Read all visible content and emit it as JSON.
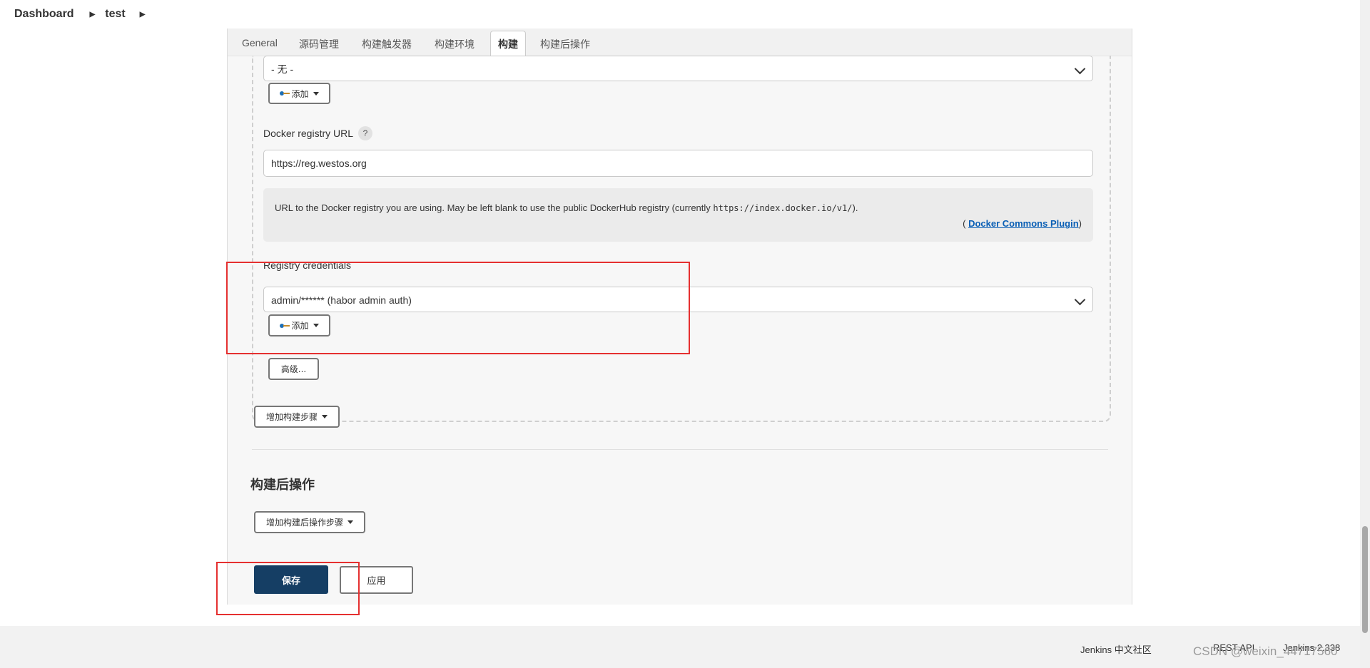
{
  "breadcrumb": {
    "root": "Dashboard",
    "job": "test"
  },
  "tabs": [
    "General",
    "源码管理",
    "构建触发器",
    "构建环境",
    "构建",
    "构建后操作"
  ],
  "active_tab": "构建",
  "credentials_top": {
    "value": "- 无 -",
    "add_label": "添加"
  },
  "docker_registry": {
    "label": "Docker registry URL",
    "help": "?",
    "value": "https://reg.westos.org",
    "help_text_before": "URL to the Docker registry you are using. May be left blank to use the public DockerHub registry (currently ",
    "help_code": "https://index.docker.io/v1/",
    "help_text_after": ").",
    "plugin_open": "(",
    "plugin_link": "Docker Commons Plugin",
    "plugin_close": ")"
  },
  "registry_credentials": {
    "label": "Registry credentials",
    "value": "admin/****** (habor admin auth)",
    "add_label": "添加"
  },
  "advanced_label": "高级...",
  "add_build_step": "增加构建步骤",
  "post_build": {
    "title": "构建后操作",
    "add_step": "增加构建后操作步骤"
  },
  "actions": {
    "save": "保存",
    "apply": "应用"
  },
  "footer": {
    "community": "Jenkins 中文社区",
    "rest_api": "REST API",
    "version": "Jenkins 2.338"
  },
  "watermark": "CSDN @weixin_44717560",
  "colors": {
    "save_bg": "#153e64",
    "highlight": "#e53030",
    "link": "#0a5fb5"
  }
}
